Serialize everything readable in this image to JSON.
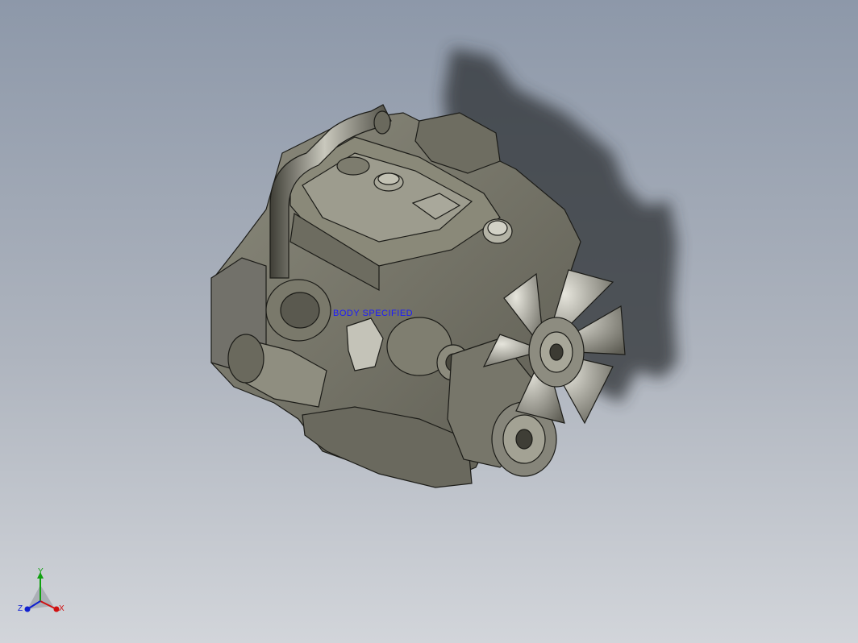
{
  "viewport": {
    "background_top": "#8e99aa",
    "background_bottom": "#d2d5da",
    "model_fill": "#7d7c6e",
    "model_edge": "#1c1c18",
    "shadow": "#2e3236"
  },
  "model": {
    "annotation_text": "BODY SPECIFIED",
    "annotation_color": "#1a1aff"
  },
  "triad": {
    "x_label": "X",
    "y_label": "Y",
    "z_label": "Z",
    "x_color": "#d01010",
    "y_color": "#10a010",
    "z_color": "#1020d0"
  }
}
